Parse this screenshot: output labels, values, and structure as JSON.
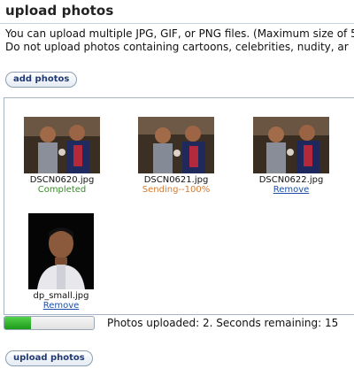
{
  "page": {
    "title": "upload photos",
    "info_line1": "You can upload multiple JPG, GIF, or PNG files. (Maximum size of 5",
    "info_line2": "Do not upload photos containing cartoons, celebrities, nudity, ar"
  },
  "buttons": {
    "add_label": "add photos",
    "upload_label": "upload photos"
  },
  "photos": [
    {
      "filename": "DSCN0620.jpg",
      "status": "Completed"
    },
    {
      "filename": "DSCN0621.jpg",
      "status": "Sending--100%"
    },
    {
      "filename": "DSCN0622.jpg",
      "status": "Remove"
    },
    {
      "filename": "dp_small.jpg",
      "status": "Remove"
    }
  ],
  "progress": {
    "fraction": 0.3,
    "text": "Photos uploaded: 2. Seconds remaining: 15"
  },
  "colors": {
    "completed": "#3a8a2a",
    "sending": "#d47a32",
    "link": "#1d4fa8",
    "progress_fill": "#22a322"
  }
}
